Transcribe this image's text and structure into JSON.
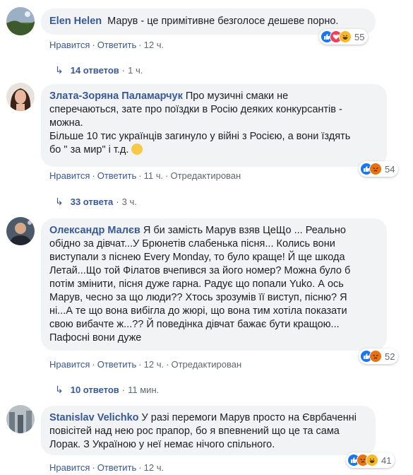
{
  "colors": {
    "link": "#385898",
    "muted": "#606770",
    "bubble": "#f2f3f5",
    "like": "#1877f2",
    "love": "#f33e58",
    "haha": "#f7b928",
    "angry": "#e9710f"
  },
  "comments": [
    {
      "author": "Elen Helen",
      "text": "Марув - це примітивне безголосе дешеве порно.",
      "reactions": [
        "like-icon",
        "love-icon",
        "haha-icon"
      ],
      "reaction_count": "55",
      "like": "Нравится",
      "reply": "Ответить",
      "time": "12 ч.",
      "edited": "",
      "replies_count": "14 ответов",
      "replies_time": "1 ч."
    },
    {
      "author": "Злата-Зоряна Паламарчук",
      "text_lines": [
        "Про музичні смаки не",
        "сперечаються, зате про поїздки в Росію деяких конкурсантів -",
        "можна.",
        "Більше 10 тис українців загинуло у війні з Росією, а вони їздять",
        "бо \" за мир\" і т.д."
      ],
      "reactions": [
        "like-icon",
        "angry-icon"
      ],
      "reaction_count": "54",
      "like": "Нравится",
      "reply": "Ответить",
      "time": "11 ч.",
      "edited": "Отредактирован",
      "replies_count": "33 ответа",
      "replies_time": "3 ч."
    },
    {
      "author": "Олександр Малєв",
      "text_lines": [
        "Я би замість Марув взяв ЦеЩо ... Реально",
        "обідно за дівчат...У Брюнетів слабенька пісня... Колись вони",
        "виступали з піснею Every Monday, то було краще! Й ще шкода",
        "Летай...Що той Філатов вчепився за його номер? Можна було б",
        "потім змінити, пісня дуже гарна. Радує що попали Yuko. А ось",
        "Марув, чесно за що люди?? Хтось зрозумів її виступ, пісню? Я",
        "ні...А те що вона вибігла до жюрі, що вона тим хотіла показати",
        "свою вибачте ж...?? Й поведінка дівчат бажає бути кращою...",
        "Пафосні вони дуже"
      ],
      "reactions": [
        "like-icon",
        "angry-icon"
      ],
      "reaction_count": "52",
      "like": "Нравится",
      "reply": "Ответить",
      "time": "12 ч.",
      "edited": "Отредактирован",
      "replies_count": "10 ответов",
      "replies_time": "11 мин."
    },
    {
      "author": "Stanislav Velichko",
      "text_lines": [
        "У разі перемоги Марув просто на Єврбаченні",
        "повісітей над нею рос прапор, бо я впевнений що це та сама",
        "Лорак. З Україною у неї немає нічого спільного."
      ],
      "reactions": [
        "like-icon",
        "angry-icon",
        "haha-icon"
      ],
      "reaction_count": "41",
      "like": "Нравится",
      "reply": "Ответить",
      "time": "12 ч.",
      "edited": ""
    }
  ]
}
